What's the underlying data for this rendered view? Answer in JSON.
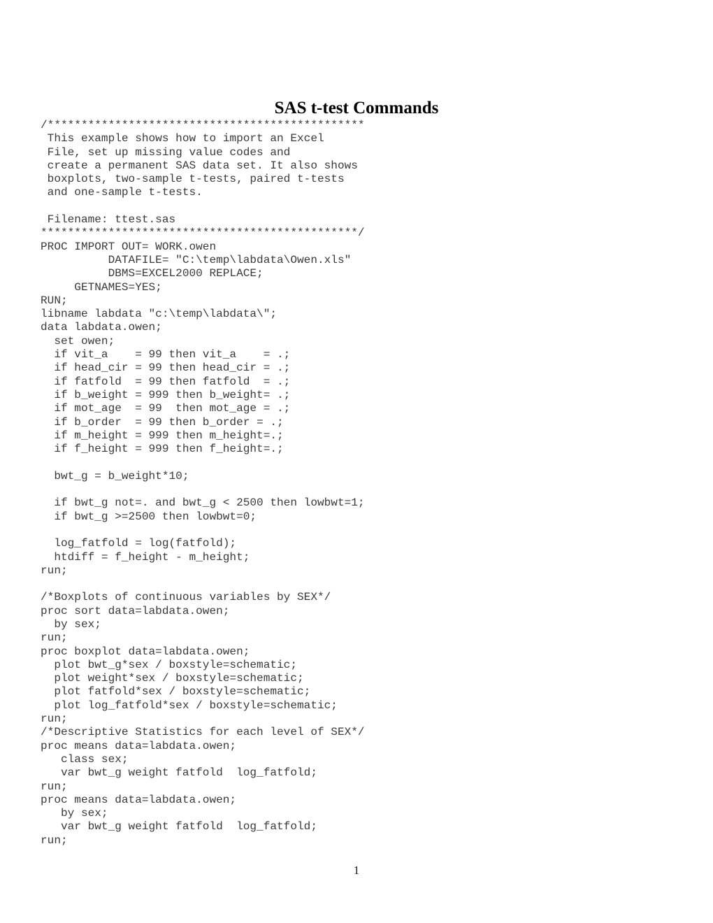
{
  "document": {
    "title": "SAS t-test Commands",
    "page_number": "1",
    "text_color": "#3a3a3a",
    "title_color": "#000000",
    "background_color": "#ffffff"
  },
  "code": {
    "language": "SAS",
    "lines": [
      "/***********************************************",
      " This example shows how to import an Excel",
      " File, set up missing value codes and",
      " create a permanent SAS data set. It also shows",
      " boxplots, two-sample t-tests, paired t-tests",
      " and one-sample t-tests.",
      "",
      " Filename: ttest.sas",
      "***********************************************/",
      "PROC IMPORT OUT= WORK.owen",
      "          DATAFILE= \"C:\\temp\\labdata\\Owen.xls\"",
      "          DBMS=EXCEL2000 REPLACE;",
      "     GETNAMES=YES;",
      "RUN;",
      "libname labdata \"c:\\temp\\labdata\\\";",
      "data labdata.owen;",
      "  set owen;",
      "  if vit_a    = 99 then vit_a    = .;",
      "  if head_cir = 99 then head_cir = .;",
      "  if fatfold  = 99 then fatfold  = .;",
      "  if b_weight = 999 then b_weight= .;",
      "  if mot_age  = 99  then mot_age = .;",
      "  if b_order  = 99 then b_order = .;",
      "  if m_height = 999 then m_height=.;",
      "  if f_height = 999 then f_height=.;",
      "",
      "  bwt_g = b_weight*10;",
      "",
      "  if bwt_g not=. and bwt_g < 2500 then lowbwt=1;",
      "  if bwt_g >=2500 then lowbwt=0;",
      "",
      "  log_fatfold = log(fatfold);",
      "  htdiff = f_height - m_height;",
      "run;",
      "",
      "/*Boxplots of continuous variables by SEX*/",
      "proc sort data=labdata.owen;",
      "  by sex;",
      "run;",
      "proc boxplot data=labdata.owen;",
      "  plot bwt_g*sex / boxstyle=schematic;",
      "  plot weight*sex / boxstyle=schematic;",
      "  plot fatfold*sex / boxstyle=schematic;",
      "  plot log_fatfold*sex / boxstyle=schematic;",
      "run;",
      "/*Descriptive Statistics for each level of SEX*/",
      "proc means data=labdata.owen;",
      "   class sex;",
      "   var bwt_g weight fatfold  log_fatfold;",
      "run;",
      "proc means data=labdata.owen;",
      "   by sex;",
      "   var bwt_g weight fatfold  log_fatfold;",
      "run;"
    ]
  }
}
